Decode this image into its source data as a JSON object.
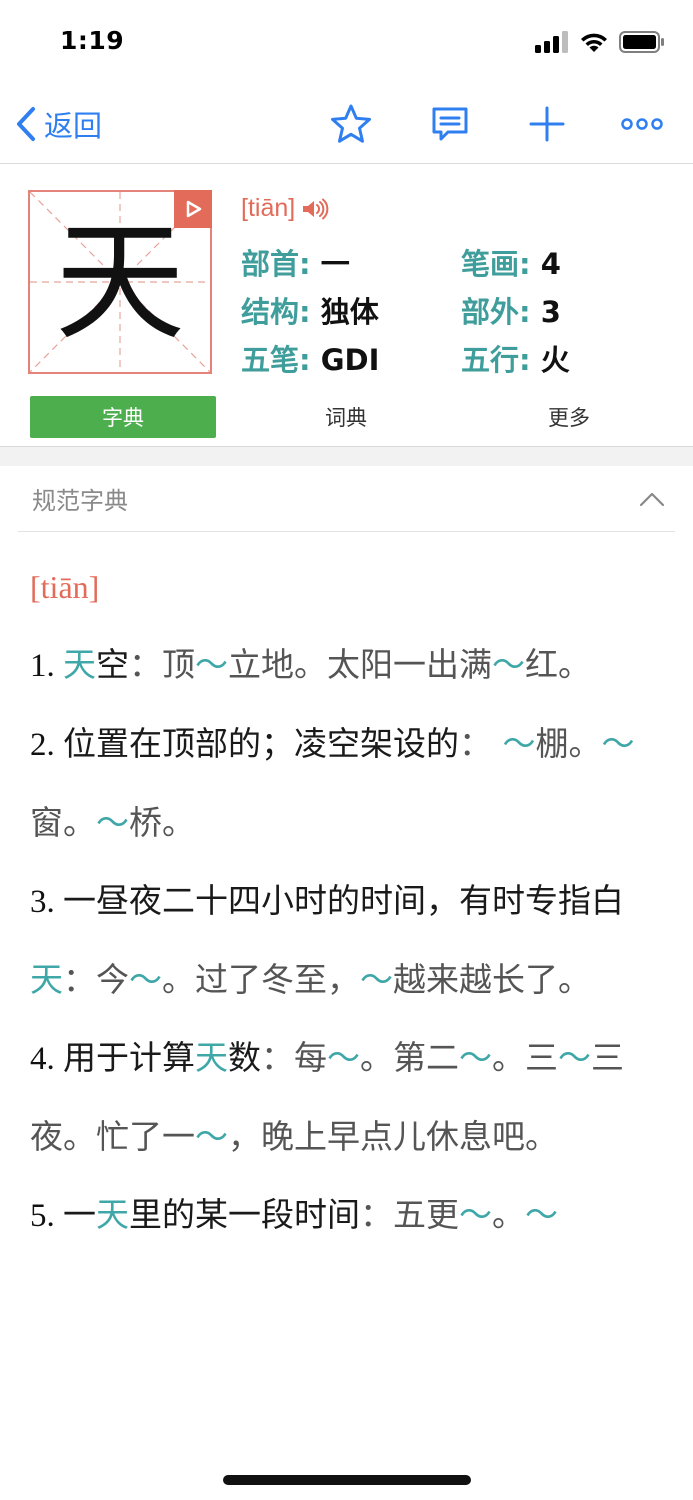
{
  "status": {
    "time": "1:19"
  },
  "nav": {
    "back_label": "返回"
  },
  "character": {
    "glyph": "天",
    "pinyin": "[tiān]",
    "info": [
      {
        "key": "部首: ",
        "value": "一"
      },
      {
        "key": "笔画: ",
        "value": "4"
      },
      {
        "key": "结构: ",
        "value": "独体"
      },
      {
        "key": "部外: ",
        "value": "3"
      },
      {
        "key": "五笔: ",
        "value": "GDI"
      },
      {
        "key": "五行: ",
        "value": "火"
      }
    ]
  },
  "tabs": [
    {
      "label": "字典",
      "active": true
    },
    {
      "label": "词典",
      "active": false
    },
    {
      "label": "更多",
      "active": false
    }
  ],
  "section": {
    "title": "规范字典"
  },
  "entry_pinyin": "[tiān]",
  "entries": [
    [
      {
        "t": "n",
        "v": "1. "
      },
      {
        "t": "h",
        "v": "天"
      },
      {
        "t": "d",
        "v": "空"
      },
      {
        "t": "e",
        "v": "："
      },
      {
        "t": "e",
        "v": "顶"
      },
      {
        "t": "h",
        "v": "～"
      },
      {
        "t": "e",
        "v": "立地。太阳一出满"
      },
      {
        "t": "h",
        "v": "～"
      },
      {
        "t": "e",
        "v": "红。"
      }
    ],
    [
      {
        "t": "n",
        "v": "2. "
      },
      {
        "t": "d",
        "v": "位置在顶部的；凌空架设的"
      },
      {
        "t": "e",
        "v": "："
      },
      {
        "t": "h",
        "v": " ～"
      },
      {
        "t": "e",
        "v": "棚。"
      },
      {
        "t": "h",
        "v": "～"
      },
      {
        "t": "e",
        "v": "窗。"
      },
      {
        "t": "h",
        "v": "～"
      },
      {
        "t": "e",
        "v": "桥。"
      }
    ],
    [
      {
        "t": "n",
        "v": "3. "
      },
      {
        "t": "d",
        "v": "一昼夜二十四小时的时间，有时专指白"
      },
      {
        "t": "h",
        "v": "天"
      },
      {
        "t": "e",
        "v": "："
      },
      {
        "t": "e",
        "v": "今"
      },
      {
        "t": "h",
        "v": "～"
      },
      {
        "t": "e",
        "v": "。过了冬至，"
      },
      {
        "t": "h",
        "v": "～"
      },
      {
        "t": "e",
        "v": "越来越长了。"
      }
    ],
    [
      {
        "t": "n",
        "v": "4. "
      },
      {
        "t": "d",
        "v": "用于计算"
      },
      {
        "t": "h",
        "v": "天"
      },
      {
        "t": "d",
        "v": "数"
      },
      {
        "t": "e",
        "v": "："
      },
      {
        "t": "e",
        "v": "每"
      },
      {
        "t": "h",
        "v": "～"
      },
      {
        "t": "e",
        "v": "。第二"
      },
      {
        "t": "h",
        "v": "～"
      },
      {
        "t": "e",
        "v": "。三"
      },
      {
        "t": "h",
        "v": "～"
      },
      {
        "t": "e",
        "v": "三夜。忙了一"
      },
      {
        "t": "h",
        "v": "～"
      },
      {
        "t": "e",
        "v": "，晚上早点儿休息吧。"
      }
    ],
    [
      {
        "t": "n",
        "v": "5. "
      },
      {
        "t": "d",
        "v": "一"
      },
      {
        "t": "h",
        "v": "天"
      },
      {
        "t": "d",
        "v": "里的某一段时间"
      },
      {
        "t": "e",
        "v": "："
      },
      {
        "t": "e",
        "v": "五更"
      },
      {
        "t": "h",
        "v": "～"
      },
      {
        "t": "e",
        "v": "。"
      },
      {
        "t": "h",
        "v": "～"
      }
    ]
  ],
  "colors": {
    "accent_blue": "#2f7ff0",
    "accent_red": "#e26b59",
    "teal": "#3f9e9b",
    "tab_green": "#4cae4c"
  }
}
